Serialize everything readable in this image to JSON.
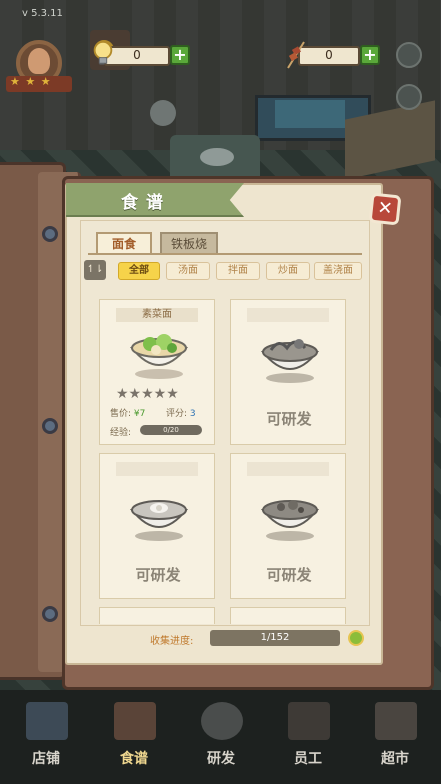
{
  "version": "v 5.3.11",
  "hud": {
    "bulbs": "0",
    "skewers": "0",
    "plus": "+"
  },
  "book": {
    "title": "食谱",
    "close": "✕",
    "tabs": [
      "面食",
      "铁板烧"
    ],
    "filters": [
      "全部",
      "汤面",
      "拌面",
      "炒面",
      "盖浇面"
    ],
    "sort_label": "↿⇂"
  },
  "recipes": [
    {
      "name": "素菜面",
      "price_label": "售价:",
      "price": "¥7",
      "score_label": "评分:",
      "score": "3",
      "exp_label": "经验:",
      "exp": "0/20",
      "stars": "★★★★★",
      "unlocked": true
    },
    {
      "name": "",
      "status": "可研发",
      "unlocked": false
    },
    {
      "name": "",
      "status": "可研发",
      "unlocked": false
    },
    {
      "name": "",
      "status": "可研发",
      "unlocked": false
    }
  ],
  "progress": {
    "label": "收集进度:",
    "value": "1/152"
  },
  "nav": [
    "店铺",
    "食谱",
    "研发",
    "员工",
    "超市"
  ],
  "colors": {
    "accent": "#8fa36d",
    "close": "#b8483a",
    "chip_on": "#f6d34a",
    "price": "#4b9a2f",
    "score": "#2f74b4"
  }
}
